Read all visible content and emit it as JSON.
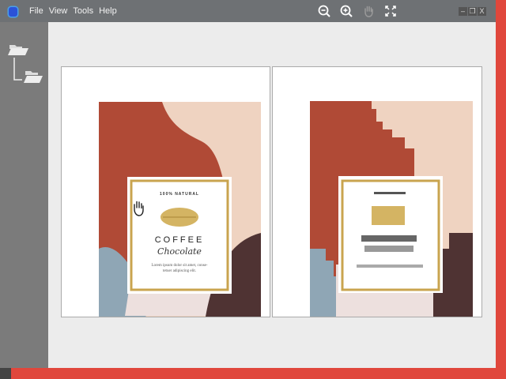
{
  "menu": {
    "items": [
      "File",
      "View",
      "Tools",
      "Help"
    ]
  },
  "toolbar": {
    "icons": [
      "zoom-out-icon",
      "zoom-in-icon",
      "hand-pan-icon",
      "fit-screen-icon"
    ]
  },
  "window_controls": {
    "minimize": "–",
    "restore": "❐",
    "close": "X"
  },
  "sidebar": {
    "icons": [
      "folder-open-icon",
      "folder-open-icon"
    ]
  },
  "label": {
    "badge": "100% NATURAL",
    "title": "COFFEE",
    "subtitle": "Chocolate",
    "body_line1": "Lorem ipsum dolor sit amet, conse-",
    "body_line2": "tetuer adipiscing elit."
  },
  "colors": {
    "rust": "#b04a36",
    "peach": "#efd3c1",
    "dark_brown": "#4f3333",
    "blue_gray": "#8fa6b5",
    "pale_pink": "#ede0de",
    "gold": "#c9a44f"
  }
}
